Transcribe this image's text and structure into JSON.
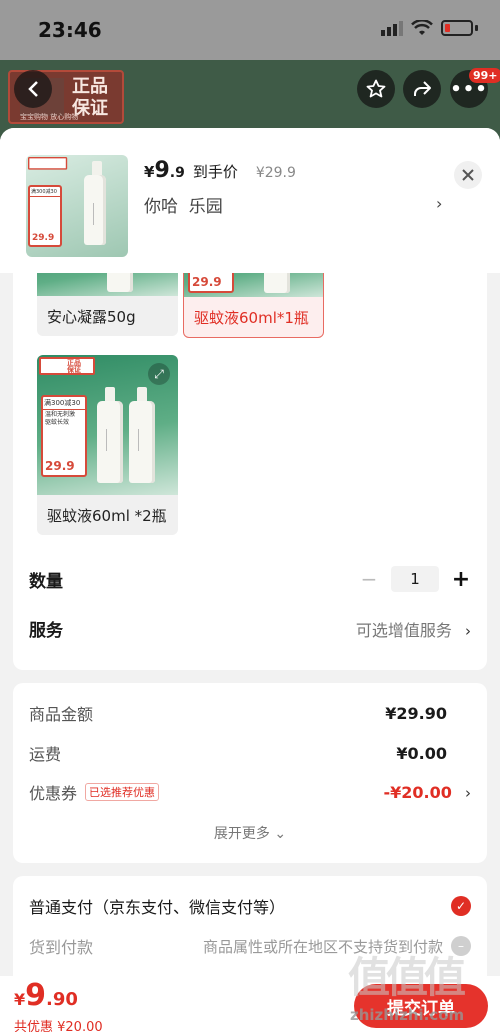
{
  "status_bar": {
    "time": "23:46"
  },
  "header": {
    "badge_main": "正品\n保证",
    "badge_logo": "倾园",
    "badge_sub": "宝宝购物  放心购物",
    "notif_count": "99+"
  },
  "sku": {
    "currency": "¥",
    "price_int": "9",
    "price_dec": ".9",
    "price_tag": "到手价",
    "original_price": "¥29.9",
    "address": "你哈  乐园",
    "thumb_promo_top": "满300减30",
    "thumb_price": "29.9"
  },
  "variants": [
    {
      "label": "安心凝露50g",
      "selected": false
    },
    {
      "label": "驱蚊液60ml*1瓶",
      "selected": true
    },
    {
      "label": "驱蚊液60ml *2瓶",
      "selected": false
    }
  ],
  "tile_promo": {
    "top": "满300减30",
    "lines": "温和无刺激\n驱蚊长效",
    "price": "29.9",
    "badge": "正品\n保证"
  },
  "options": {
    "quantity_label": "数量",
    "quantity_value": "1",
    "minus": "−",
    "plus": "+",
    "service_label": "服务",
    "service_value": "可选增值服务"
  },
  "summary": {
    "goods_label": "商品金额",
    "goods_value": "¥29.90",
    "shipping_label": "运费",
    "shipping_value": "¥0.00",
    "coupon_label": "优惠券",
    "coupon_tag": "已选推荐优惠",
    "coupon_value": "-¥20.00",
    "expand_more": "展开更多"
  },
  "payment": {
    "normal_pay": "普通支付（京东支付、微信支付等）",
    "cod_label": "货到付款",
    "cod_note": "商品属性或所在地区不支持货到付款"
  },
  "bottom": {
    "currency": "¥",
    "total_int": "9",
    "total_dec": ".90",
    "discount": "共优惠 ¥20.00",
    "submit": "提交订单"
  },
  "watermark": {
    "big": "值值值",
    "small": "zhizhizhi.com"
  },
  "colors": {
    "accent": "#e02e24",
    "header_green": "#3f5b47"
  }
}
